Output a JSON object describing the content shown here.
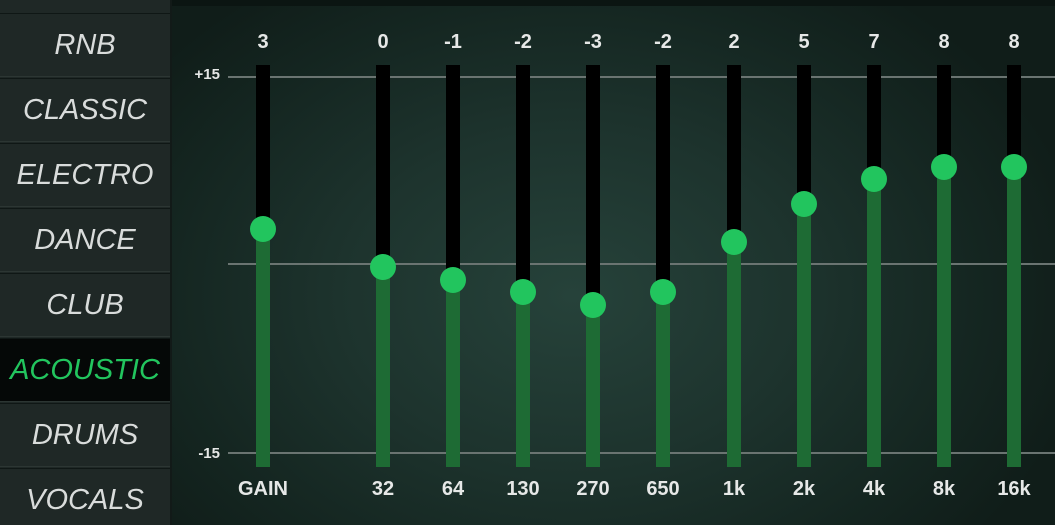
{
  "presets": [
    "RNB",
    "CLASSIC",
    "ELECTRO",
    "DANCE",
    "CLUB",
    "ACOUSTIC",
    "DRUMS",
    "VOCALS"
  ],
  "selected_preset": "ACOUSTIC",
  "scale": {
    "max_label": "+15",
    "min_label": "-15",
    "max": 15,
    "min": -15
  },
  "accent_color": "#22c55e",
  "fill_color": "#1e6b34",
  "bands": [
    {
      "label": "GAIN",
      "value": 3
    },
    {
      "label": "32",
      "value": 0
    },
    {
      "label": "64",
      "value": -1
    },
    {
      "label": "130",
      "value": -2
    },
    {
      "label": "270",
      "value": -3
    },
    {
      "label": "650",
      "value": -2
    },
    {
      "label": "1k",
      "value": 2
    },
    {
      "label": "2k",
      "value": 5
    },
    {
      "label": "4k",
      "value": 7
    },
    {
      "label": "8k",
      "value": 8
    },
    {
      "label": "16k",
      "value": 8
    }
  ]
}
